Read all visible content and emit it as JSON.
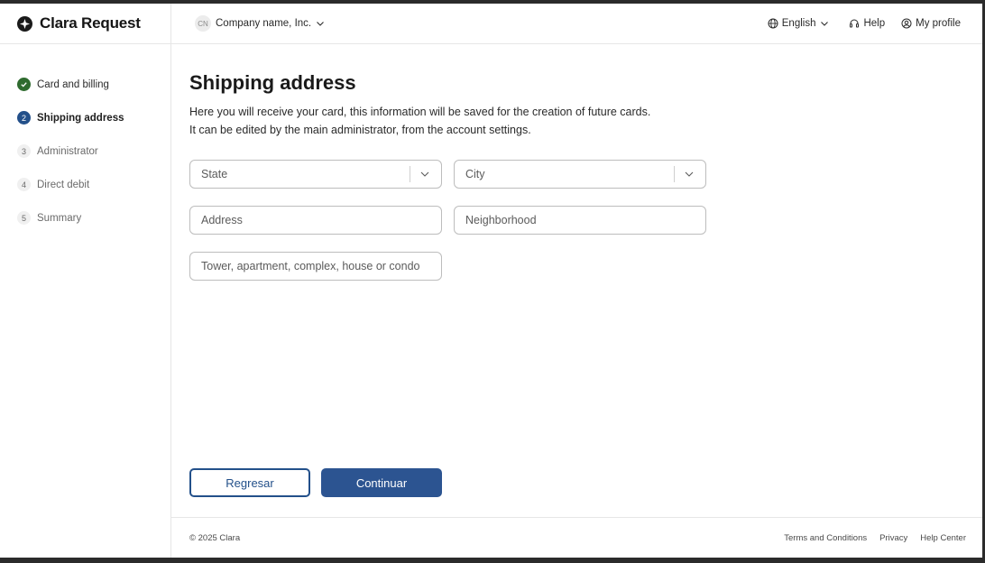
{
  "header": {
    "brand_name": "Clara Request",
    "company_initials": "CN",
    "company_name": "Company name, Inc.",
    "language": "English",
    "help": "Help",
    "profile": "My profile"
  },
  "sidebar": {
    "steps": [
      {
        "badge": "",
        "label": "Card and billing",
        "state": "done"
      },
      {
        "badge": "2",
        "label": "Shipping address",
        "state": "active"
      },
      {
        "badge": "3",
        "label": "Administrator",
        "state": "pending"
      },
      {
        "badge": "4",
        "label": "Direct debit",
        "state": "pending"
      },
      {
        "badge": "5",
        "label": "Summary",
        "state": "pending"
      }
    ]
  },
  "main": {
    "title": "Shipping address",
    "description_line1": "Here you will receive your card, this information will be saved for the creation of future cards.",
    "description_line2": "It can be edited by the main administrator, from the account settings.",
    "state_select": "State",
    "city_select": "City",
    "address_placeholder": "Address",
    "neighborhood_placeholder": "Neighborhood",
    "unit_placeholder": "Tower, apartment, complex, house or condo",
    "back_button": "Regresar",
    "next_button": "Continuar"
  },
  "footer": {
    "copyright": "© 2025 Clara",
    "links": [
      "Terms and Conditions",
      "Privacy",
      "Help Center"
    ]
  },
  "colors": {
    "primary": "#2c5491",
    "done": "#2f6b2f"
  }
}
